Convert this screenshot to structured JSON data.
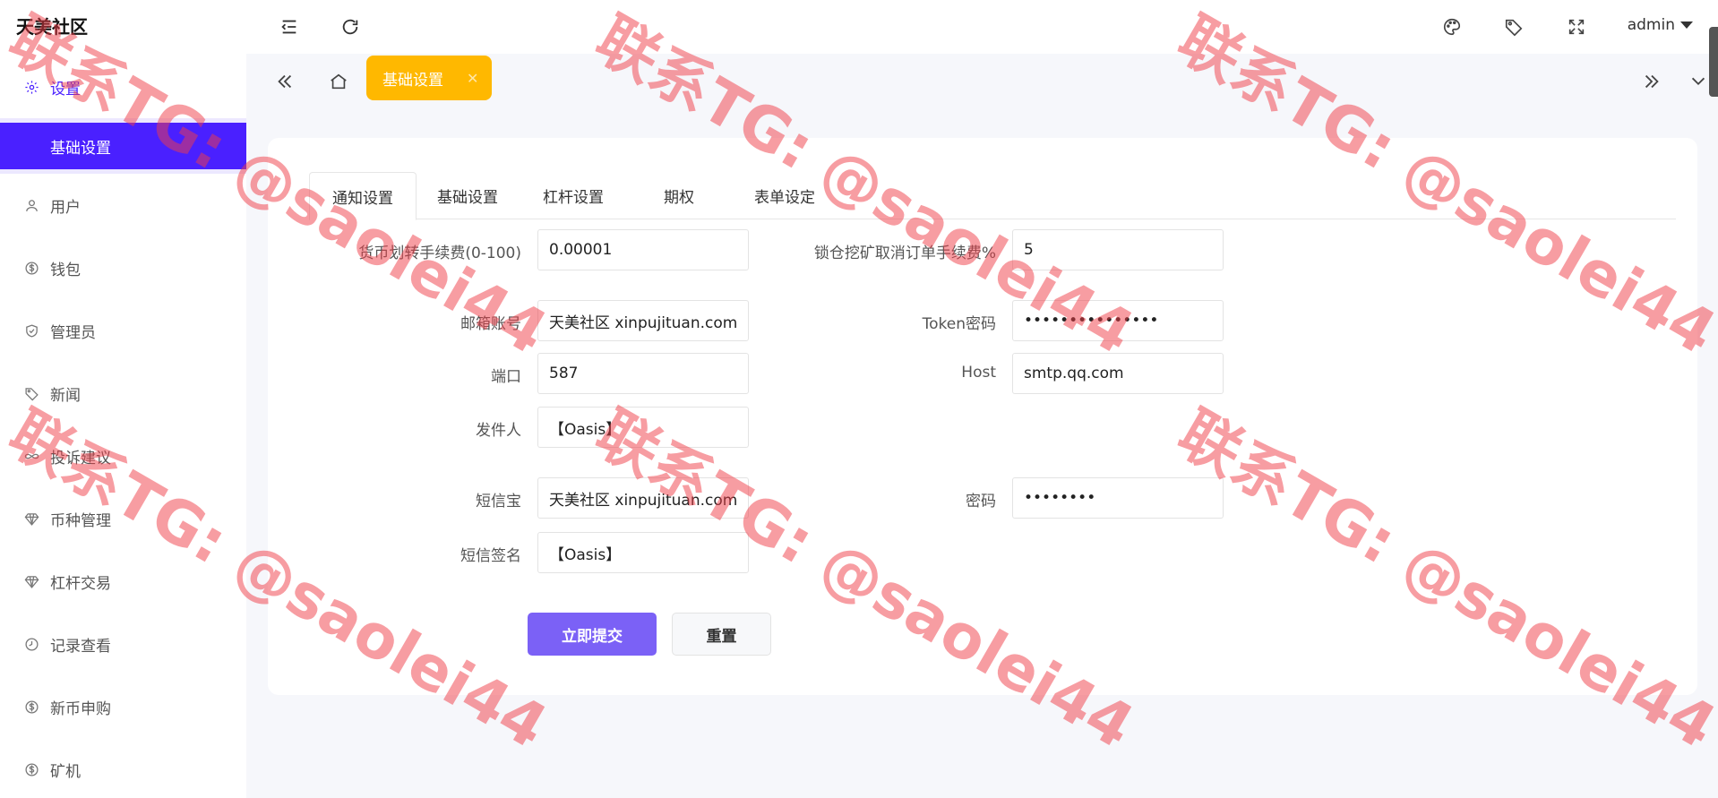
{
  "brand": "天美社区",
  "sidebar": {
    "items": [
      {
        "label": "设置",
        "icon": "gear-icon"
      },
      {
        "label": "基础设置"
      },
      {
        "label": "用户",
        "icon": "user-icon"
      },
      {
        "label": "钱包",
        "icon": "dollar-circle-icon"
      },
      {
        "label": "管理员",
        "icon": "shield-check-icon"
      },
      {
        "label": "新闻",
        "icon": "tag-icon"
      },
      {
        "label": "投诉建议",
        "icon": "infinity-icon"
      },
      {
        "label": "币种管理",
        "icon": "diamond-icon"
      },
      {
        "label": "杠杆交易",
        "icon": "diamond-icon"
      },
      {
        "label": "记录查看",
        "icon": "clock-circle-icon"
      },
      {
        "label": "新币申购",
        "icon": "dollar-circle-icon"
      },
      {
        "label": "矿机",
        "icon": "dollar-circle-icon"
      }
    ]
  },
  "topbar": {
    "admin_label": "admin"
  },
  "tabbar": {
    "active_tag": "基础设置",
    "close_symbol": "✕"
  },
  "tabs": [
    "通知设置",
    "基础设置",
    "杠杆设置",
    "期权",
    "表单设定"
  ],
  "form": {
    "transfer_fee_label": "货币划转手续费(0-100)",
    "transfer_fee_value": "0.00001",
    "lock_fee_label": "锁仓挖矿取消订单手续费%",
    "lock_fee_value": "5",
    "email_label": "邮箱账号",
    "email_value": "天美社区 xinpujituan.com",
    "token_label": "Token密码",
    "token_value": "•••••••••••••••",
    "port_label": "端口",
    "port_value": "587",
    "host_label": "Host",
    "host_value": "smtp.qq.com",
    "sender_label": "发件人",
    "sender_value": "【Oasis】",
    "sms_label": "短信宝",
    "sms_value": "天美社区 xinpujituan.com",
    "password_label": "密码",
    "password_value": "••••••••",
    "sms_sign_label": "短信签名",
    "sms_sign_value": "【Oasis】"
  },
  "buttons": {
    "submit": "立即提交",
    "reset": "重置"
  },
  "watermark": "联系TG: @saolei44",
  "colors": {
    "primary": "#4a20ff",
    "tag": "#ffb800",
    "submit": "#7b61f6",
    "watermark": "#f03c46"
  }
}
